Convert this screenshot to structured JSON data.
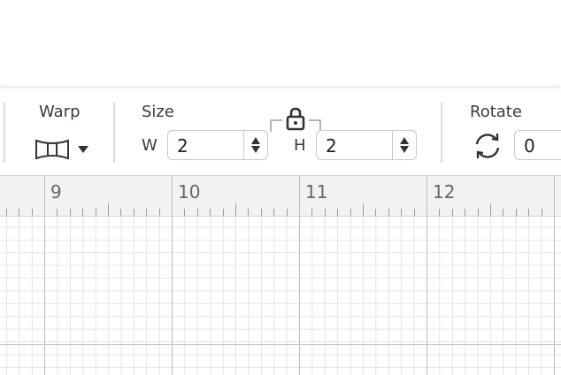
{
  "toolbar": {
    "warp_label": "Warp",
    "size_label": "Size",
    "width_letter": "W",
    "width_value": "2",
    "height_letter": "H",
    "height_value": "2",
    "rotate_label": "Rotate",
    "rotate_value": "0"
  },
  "ruler": {
    "numbers": [
      "9",
      "10",
      "11",
      "12"
    ]
  },
  "icons": {
    "warp": "warp-shape-icon",
    "warp_dropdown": "chevron-down-icon",
    "lock": "lock-icon",
    "rotate": "rotate-icon",
    "spinner_up": "arrow-up-icon",
    "spinner_down": "arrow-down-icon"
  }
}
